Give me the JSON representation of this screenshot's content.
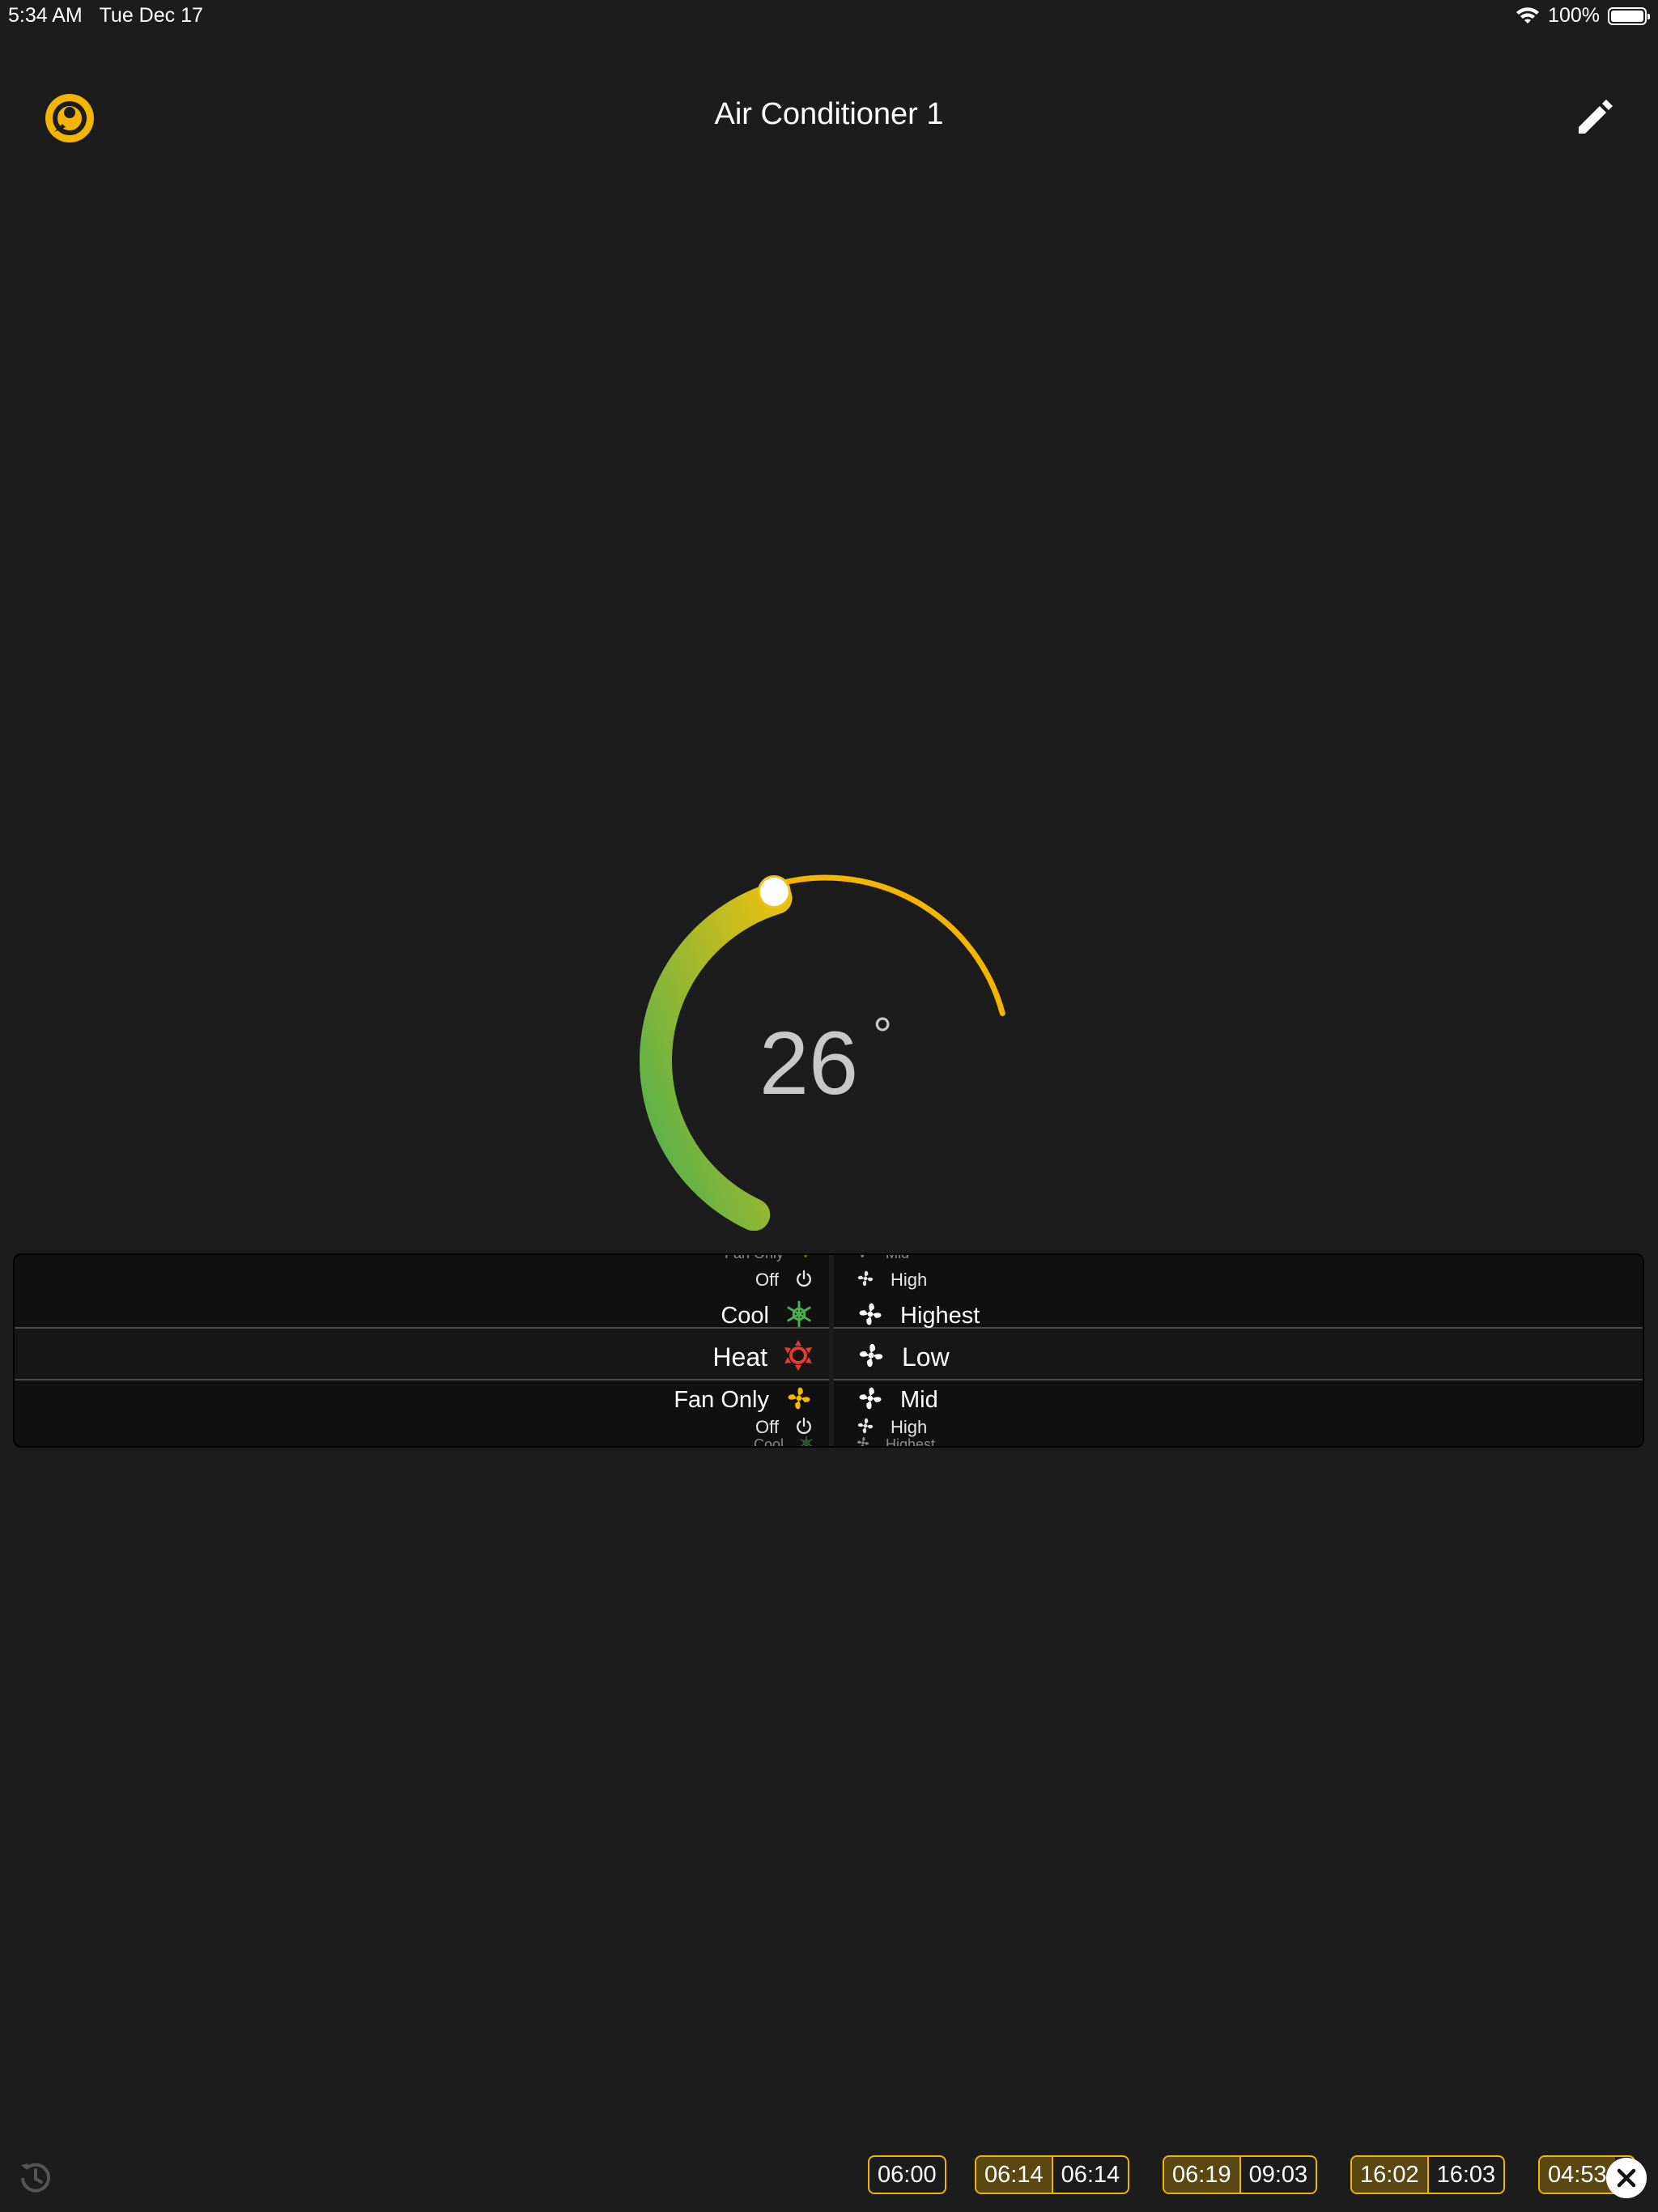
{
  "status_bar": {
    "time": "5:34 AM",
    "date": "Tue Dec 17",
    "battery": "100%"
  },
  "header": {
    "title": "Air Conditioner 1"
  },
  "thermostat": {
    "temperature": "26",
    "unit": "°",
    "setpoint_fraction": 0.6
  },
  "mode_picker": {
    "items": [
      {
        "label": "Fan Only",
        "icon": "fan-icon",
        "color": "#f5b900"
      },
      {
        "label": "Off",
        "icon": "power-icon",
        "color": "#ffffff"
      },
      {
        "label": "Cool",
        "icon": "snowflake-icon",
        "color": "#4caf50"
      },
      {
        "label": "Heat",
        "icon": "sun-icon",
        "color": "#e53935"
      },
      {
        "label": "Fan Only",
        "icon": "fan-icon",
        "color": "#f5b900"
      },
      {
        "label": "Off",
        "icon": "power-icon",
        "color": "#ffffff"
      },
      {
        "label": "Cool",
        "icon": "snowflake-icon",
        "color": "#4caf50"
      }
    ],
    "selected": "Heat"
  },
  "fan_picker": {
    "items": [
      {
        "label": "Mid",
        "icon": "fan-icon"
      },
      {
        "label": "High",
        "icon": "fan-icon"
      },
      {
        "label": "Highest",
        "icon": "fan-icon"
      },
      {
        "label": "Low",
        "icon": "fan-icon"
      },
      {
        "label": "Mid",
        "icon": "fan-icon"
      },
      {
        "label": "High",
        "icon": "fan-icon"
      },
      {
        "label": "Highest",
        "icon": "fan-icon"
      }
    ],
    "selected": "Low"
  },
  "timeline": {
    "chips": [
      {
        "start": "06:00",
        "end": ""
      },
      {
        "start": "06:14",
        "end": "06:14"
      },
      {
        "start": "06:19",
        "end": "09:03"
      },
      {
        "start": "16:02",
        "end": "16:03"
      },
      {
        "start": "04:53",
        "end": ""
      }
    ]
  },
  "colors": {
    "accent": "#f5b400",
    "gauge_start": "#4caf50",
    "gauge_end": "#f5b400",
    "background": "#1c1c1c"
  }
}
